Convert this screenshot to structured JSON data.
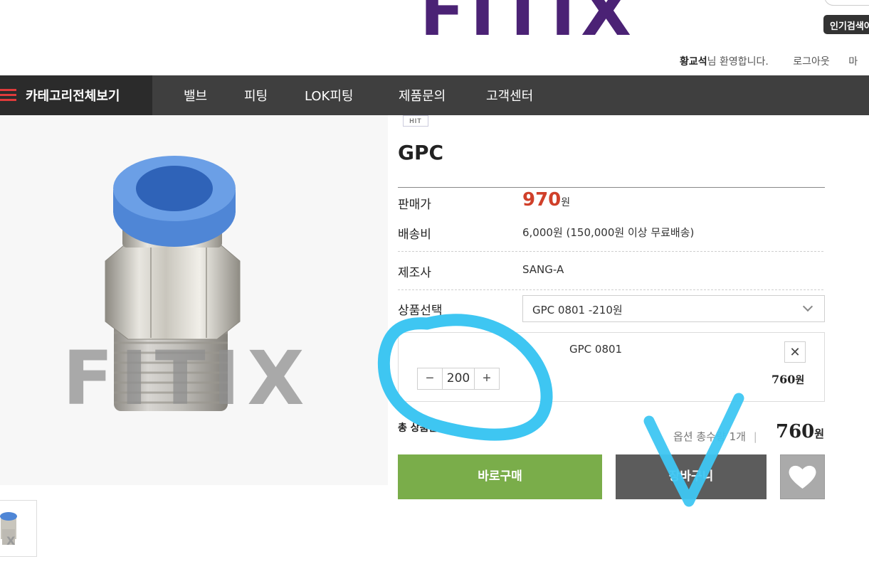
{
  "header": {
    "logo": "FITIX",
    "popular_search": "인기검색어",
    "user_name": "황교석",
    "welcome_suffix": "님 환영합니다.",
    "logout": "로그아웃",
    "mypage_partial": "마"
  },
  "nav": {
    "category_all": "카테고리전체보기",
    "items": [
      "밸브",
      "피팅",
      "LOK피팅",
      "제품문의",
      "고객센터"
    ]
  },
  "product": {
    "badge": "HIT",
    "name": "GPC",
    "image_watermark": "FITIX",
    "price_label": "판매가",
    "price": "970",
    "currency": "원",
    "shipping_label": "배송비",
    "shipping_value": "6,000원 (150,000원 이상 무료배송)",
    "maker_label": "제조사",
    "maker_value": "SANG-A",
    "option_label": "상품선택",
    "option_selected": "GPC 0801 -210원"
  },
  "selected_option": {
    "name": "GPC 0801",
    "quantity": "200",
    "minus": "−",
    "plus": "+",
    "remove": "✕",
    "price": "760",
    "currency": "원"
  },
  "total": {
    "label": "총 상품금액 :",
    "count_label": "옵션 총수량",
    "count_value": "1개",
    "separator": "|",
    "price": "760",
    "currency": "원"
  },
  "buttons": {
    "buy_now": "바로구매",
    "cart": "장바구니"
  },
  "colors": {
    "logo": "#4b2275",
    "price": "#d0402a",
    "buy_button": "#7aad4a",
    "cart_button": "#5c5c5c",
    "annotation": "#3ec6f2"
  }
}
